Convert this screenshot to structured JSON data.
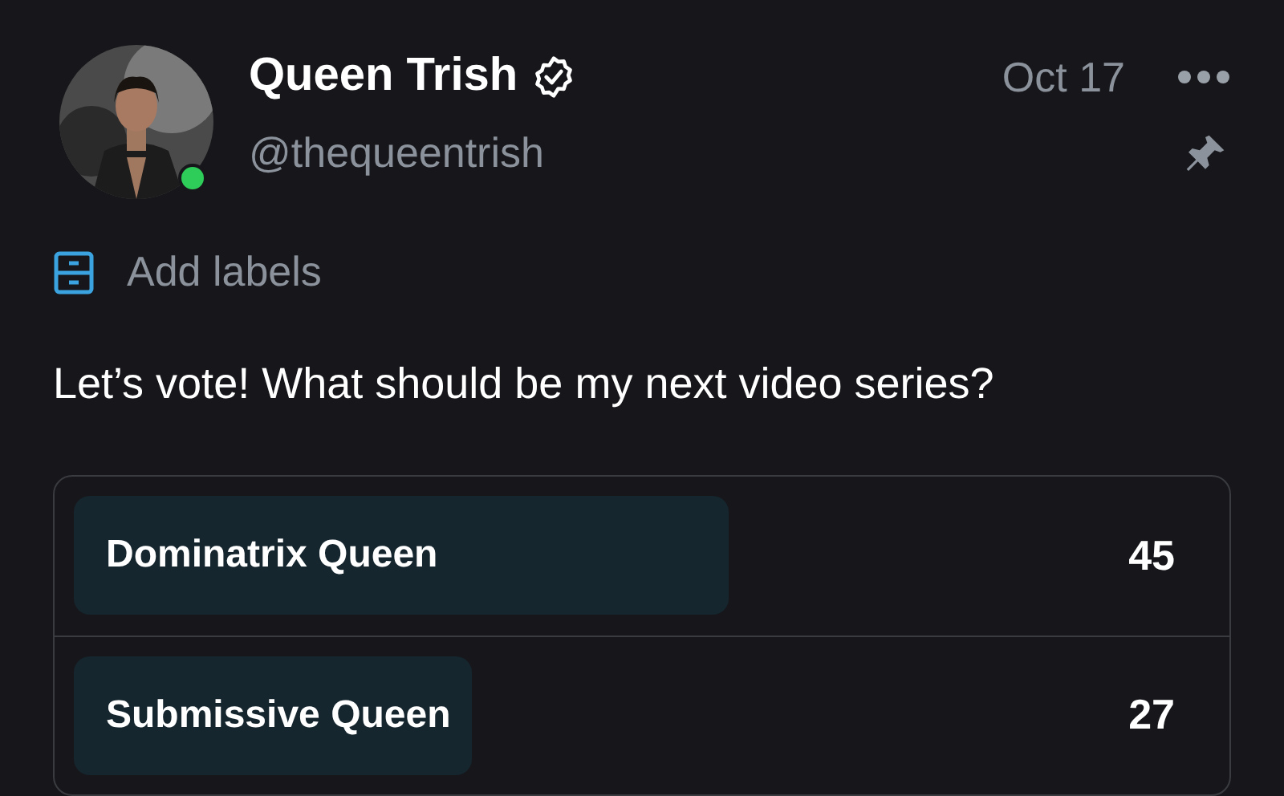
{
  "post": {
    "author": "Queen Trish",
    "verified": true,
    "online": true,
    "handle": "@thequeentrish",
    "date": "Oct 17",
    "pinned": true,
    "labels_action": "Add labels",
    "text": "Let’s vote! What should be my next video series?"
  },
  "poll": {
    "options": [
      {
        "label": "Dominatrix Queen",
        "count": "45",
        "level": 0.64
      },
      {
        "label": "Submissive Queen",
        "count": "27",
        "level": 0.39
      }
    ]
  }
}
